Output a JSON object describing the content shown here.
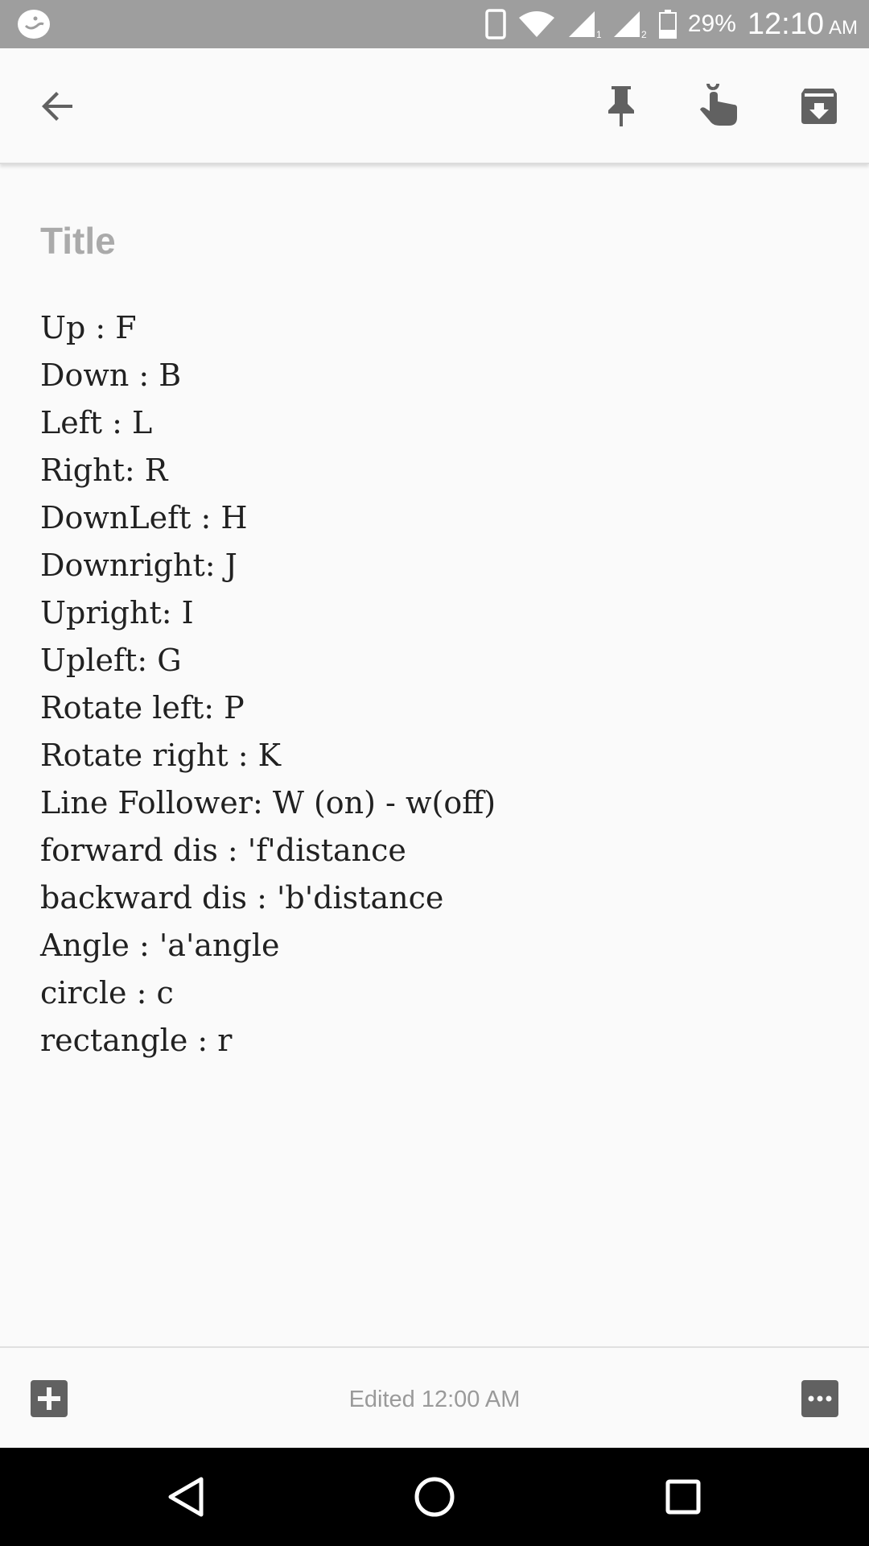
{
  "status_bar": {
    "battery_percent": "29%",
    "time": "12:10",
    "ampm": "AM",
    "icons": [
      "notification-icon",
      "phone-icon",
      "wifi-icon",
      "signal-sim1-icon",
      "signal-sim2-icon",
      "battery-icon"
    ]
  },
  "app_bar": {
    "icons": [
      "back-arrow-icon",
      "pin-icon",
      "reminder-hand-icon",
      "archive-icon"
    ]
  },
  "note": {
    "title_placeholder": "Title",
    "lines": [
      "Up : F",
      "Down : B",
      "Left : L",
      "Right: R",
      "DownLeft : H",
      "Downright: J",
      "Upright: I",
      "Upleft: G",
      "Rotate left: P",
      "Rotate right : K",
      "Line Follower: W (on) - w(off)",
      "forward dis : 'f'distance",
      "backward dis : 'b'distance",
      "Angle : 'a'angle",
      "circle : c",
      "rectangle : r"
    ]
  },
  "bottom_bar": {
    "edited_text": "Edited 12:00 AM",
    "icons": [
      "add-box-icon",
      "more-options-icon"
    ]
  },
  "nav_bar": {
    "icons": [
      "nav-back-icon",
      "nav-home-icon",
      "nav-recents-icon"
    ]
  },
  "colors": {
    "status_bar_bg": "#9e9e9e",
    "page_bg": "#fafafa",
    "icon_gray": "#616161",
    "title_placeholder": "#aaaaaa",
    "body_text": "#212121",
    "nav_bar_bg": "#000000"
  }
}
